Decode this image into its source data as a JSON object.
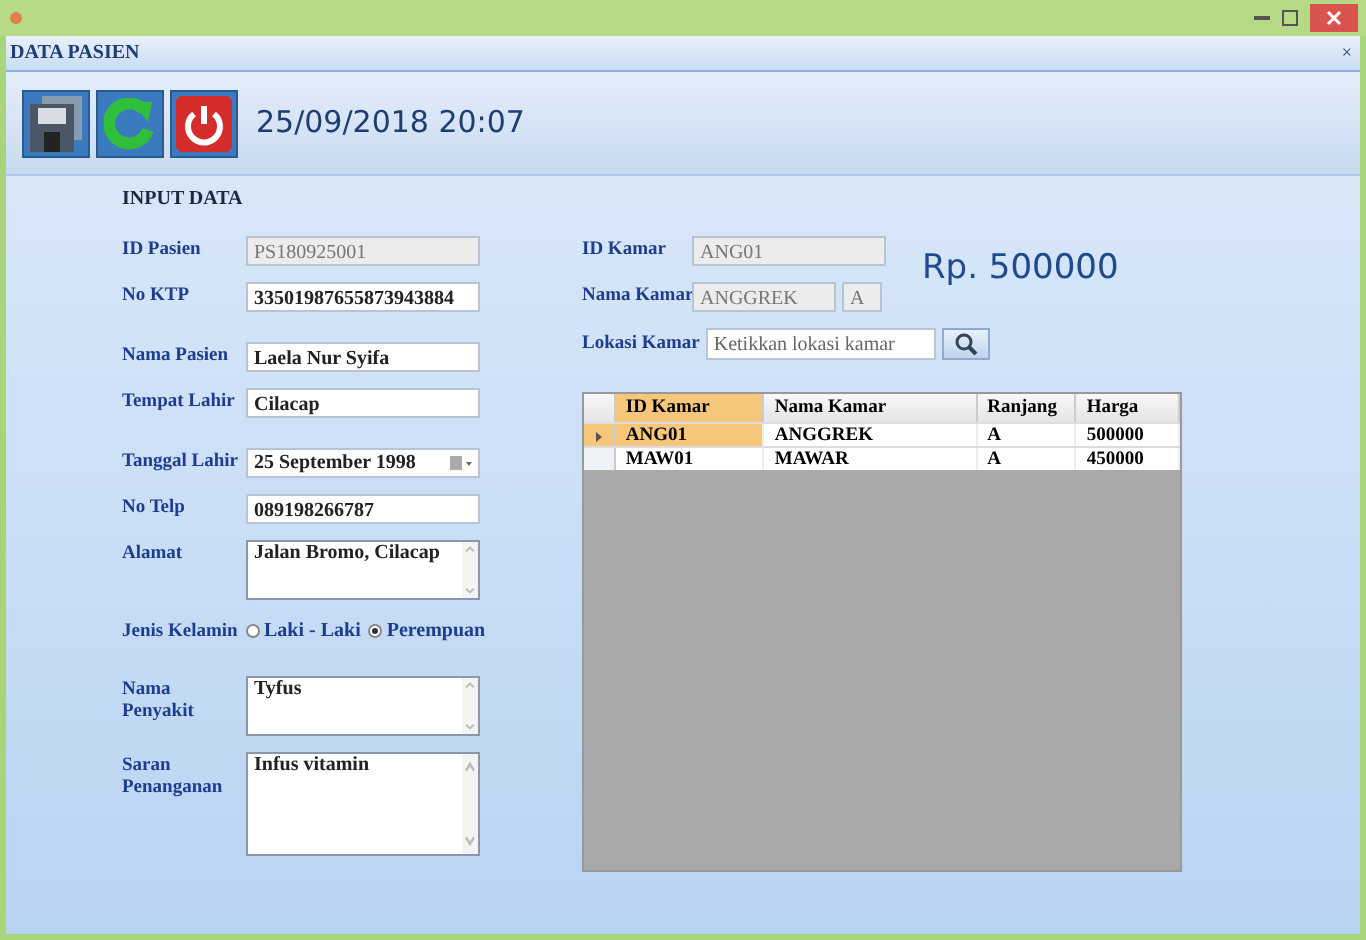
{
  "window": {
    "title_tab": "DATA PASIEN",
    "tab_pin": "×"
  },
  "toolbar": {
    "datetime": "25/09/2018 20:07"
  },
  "section_title": "INPUT DATA",
  "left_fields": [
    {
      "kind": "text",
      "label": "ID Pasien",
      "value": "PS180925001",
      "disabled": true
    },
    {
      "kind": "text",
      "label": "No KTP",
      "value": "33501987655873943884",
      "disabled": false
    },
    {
      "kind": "text",
      "label": "Nama Pasien",
      "value": "Laela Nur Syifa",
      "disabled": false
    },
    {
      "kind": "text",
      "label": "Tempat Lahir",
      "value": "Cilacap",
      "disabled": false
    },
    {
      "kind": "date",
      "label": "Tanggal Lahir",
      "value": "25 September 1998"
    },
    {
      "kind": "text",
      "label": "No Telp",
      "value": "089198266787",
      "disabled": false
    },
    {
      "kind": "textarea",
      "label": "Alamat",
      "value": "Jalan Bromo, Cilacap"
    },
    {
      "kind": "radio",
      "label": "Jenis Kelamin",
      "options": [
        {
          "label": "Laki - Laki",
          "selected": false
        },
        {
          "label": "Perempuan",
          "selected": true
        }
      ]
    },
    {
      "kind": "textarea",
      "label": "Nama Penyakit",
      "value": "Tyfus"
    },
    {
      "kind": "tallarea",
      "label": "Saran Penanganan",
      "value": "Infus vitamin"
    }
  ],
  "room": {
    "id_label": "ID Kamar",
    "id_value": "ANG01",
    "name_label": "Nama Kamar",
    "name_value": "ANGGREK",
    "bed_value": "A",
    "location_label": "Lokasi Kamar",
    "location_placeholder": "Ketikkan lokasi kamar",
    "price": "Rp. 500000"
  },
  "table": {
    "columns": [
      "ID Kamar",
      "Nama Kamar",
      "Ranjang",
      "Harga"
    ],
    "rows": [
      {
        "cells": [
          "ANG01",
          "ANGGREK",
          "A",
          "500000"
        ],
        "selected": true
      },
      {
        "cells": [
          "MAW01",
          "MAWAR",
          "A",
          "450000"
        ],
        "selected": false
      }
    ]
  }
}
